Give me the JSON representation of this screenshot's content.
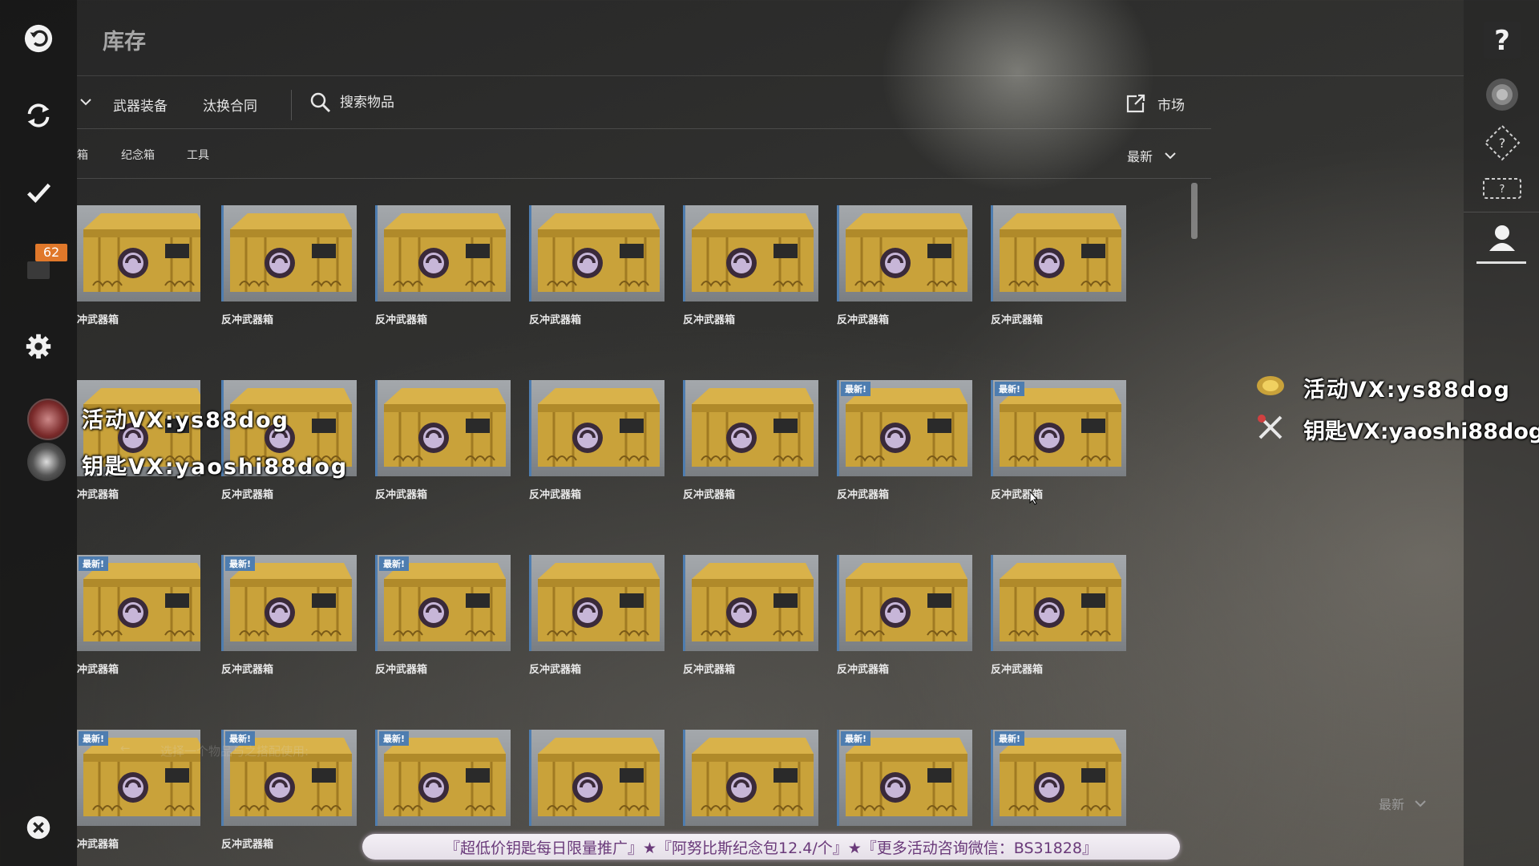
{
  "page_title": "库存",
  "tabs": [
    {
      "label": "武器装备"
    },
    {
      "label": "汰换合同"
    }
  ],
  "search": {
    "placeholder": "搜索物品"
  },
  "market_label": "市场",
  "sub_tabs": [
    {
      "label": "箱"
    },
    {
      "label": "纪念箱"
    },
    {
      "label": "工具"
    }
  ],
  "sort_label": "最新",
  "notification_count": "62",
  "grid": {
    "new_tag_label": "最新!",
    "rows": [
      [
        {
          "name": "冲武器箱",
          "new": false
        },
        {
          "name": "反冲武器箱",
          "new": false
        },
        {
          "name": "反冲武器箱",
          "new": false
        },
        {
          "name": "反冲武器箱",
          "new": false
        },
        {
          "name": "反冲武器箱",
          "new": false
        },
        {
          "name": "反冲武器箱",
          "new": false
        },
        {
          "name": "反冲武器箱",
          "new": false
        }
      ],
      [
        {
          "name": "冲武器箱",
          "new": false
        },
        {
          "name": "反冲武器箱",
          "new": false
        },
        {
          "name": "反冲武器箱",
          "new": false
        },
        {
          "name": "反冲武器箱",
          "new": false
        },
        {
          "name": "反冲武器箱",
          "new": false
        },
        {
          "name": "反冲武器箱",
          "new": true
        },
        {
          "name": "反冲武器箱",
          "new": true
        }
      ],
      [
        {
          "name": "冲武器箱",
          "new": true
        },
        {
          "name": "反冲武器箱",
          "new": true
        },
        {
          "name": "反冲武器箱",
          "new": true
        },
        {
          "name": "反冲武器箱",
          "new": false
        },
        {
          "name": "反冲武器箱",
          "new": false
        },
        {
          "name": "反冲武器箱",
          "new": false
        },
        {
          "name": "反冲武器箱",
          "new": false
        }
      ],
      [
        {
          "name": "冲武器箱",
          "new": true
        },
        {
          "name": "反冲武器箱",
          "new": true
        },
        {
          "name": "反冲武器箱",
          "new": true
        },
        {
          "name": "反冲武器箱",
          "new": false
        },
        {
          "name": "反冲武器箱",
          "new": false
        },
        {
          "name": "反冲武器箱",
          "new": true
        },
        {
          "name": "反冲武器箱",
          "new": true
        }
      ]
    ]
  },
  "overlay": {
    "left_line1": "活动VX:ys88dog",
    "left_line2": "钥匙VX:yaoshi88dog",
    "right_line1": "活动VX:ys88dog",
    "right_line2": "钥匙VX:yaoshi88dog"
  },
  "ghost_hint": "选择一个物品与之搭配使用:",
  "bottom_sort_label": "最新",
  "ticker_text": "『超低价钥匙每日限量推广』★『阿努比斯纪念包12.4/个』★『更多活动咨询微信：BS31828』",
  "colors": {
    "accent_blue": "#4e7db0",
    "badge_orange": "#e0782a",
    "case_gold": "#c9a23a"
  }
}
